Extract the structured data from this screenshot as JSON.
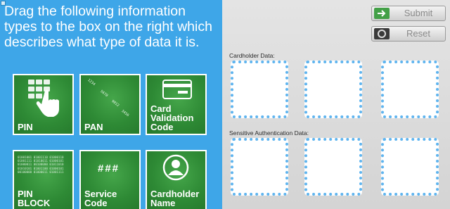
{
  "instructions": {
    "text": "Drag the following information types to the box on the right which describes what type of data it is."
  },
  "tiles": [
    {
      "label": "PIN",
      "icon": "keypad-hand-icon"
    },
    {
      "label": "PAN",
      "icon": "card-number-digits-icon",
      "digits": [
        "1234",
        "5678",
        "9012",
        "3456"
      ]
    },
    {
      "label": "Card\nValidation\nCode",
      "icon": "credit-card-icon"
    },
    {
      "label": "PIN\nBLOCK",
      "icon": "binary-data-icon",
      "binary": "01001001 01001110 01000110\n01001111 01010011 01000101\n01000011 00100000 01011010\n01010101 01001100 01000101\n00100000 01000011 01001111"
    },
    {
      "label": "Service\nCode",
      "icon": "hash-symbols-icon",
      "symbols": "###"
    },
    {
      "label": "Cardholder\nName",
      "icon": "person-avatar-icon"
    }
  ],
  "buttons": {
    "submit": {
      "label": "Submit",
      "icon": "arrow-right-icon"
    },
    "reset": {
      "label": "Reset",
      "icon": "circle-icon"
    }
  },
  "sections": {
    "cardholder": {
      "label": "Cardholder Data:"
    },
    "sensitive": {
      "label": "Sensitive Authentication Data:"
    }
  },
  "colors": {
    "left_background": "#3ea6e8",
    "tile_green": "#2f8f38",
    "drop_border": "#5eb4ef",
    "submit_icon": "#43a047",
    "reset_icon": "#3a3a3a"
  }
}
